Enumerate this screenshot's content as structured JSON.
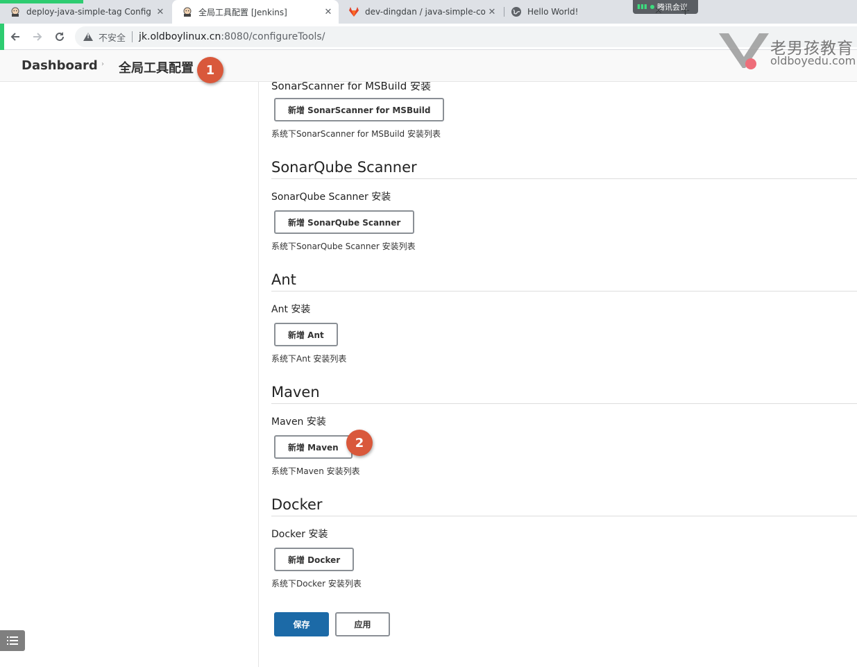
{
  "browser": {
    "tabs": [
      {
        "title": "deploy-java-simple-tag Config",
        "close": "✕"
      },
      {
        "title": "全局工具配置 [Jenkins]",
        "close": "✕"
      },
      {
        "title": "dev-dingdan / java-simple-co",
        "close": "✕"
      },
      {
        "title": "Hello World!",
        "close": ""
      }
    ],
    "meeting_badge": "腾讯会议",
    "tab_close_extra": "✕",
    "new_tab": "+",
    "security_label": "不安全",
    "url_host": "jk.oldboylinux.cn",
    "url_rest": ":8080/configureTools/"
  },
  "watermark": {
    "title": "老男孩教育",
    "domain": "oldboyedu.com"
  },
  "breadcrumb": {
    "home": "Dashboard",
    "separator": "›",
    "current": "全局工具配置"
  },
  "annotations": {
    "badge1": "1",
    "badge2": "2"
  },
  "content": {
    "cutoff_label": "SonarScanner for MSBuild 安装",
    "sonar_msbuild_button": "新增 SonarScanner for MSBuild",
    "sonar_msbuild_hint": "系统下SonarScanner for MSBuild 安装列表",
    "sections": [
      {
        "title": "SonarQube Scanner",
        "label": "SonarQube Scanner 安装",
        "button": "新增 SonarQube Scanner",
        "hint": "系统下SonarQube Scanner 安装列表"
      },
      {
        "title": "Ant",
        "label": "Ant 安装",
        "button": "新增 Ant",
        "hint": "系统下Ant 安装列表"
      },
      {
        "title": "Maven",
        "label": "Maven 安装",
        "button": "新增 Maven",
        "hint": "系统下Maven 安装列表"
      },
      {
        "title": "Docker",
        "label": "Docker 安装",
        "button": "新增 Docker",
        "hint": "系统下Docker 安装列表"
      }
    ],
    "save": "保存",
    "apply": "应用"
  },
  "colors": {
    "accent_green": "#2ecc71",
    "save_blue": "#1c6aa7",
    "badge_red": "#d9583b"
  }
}
